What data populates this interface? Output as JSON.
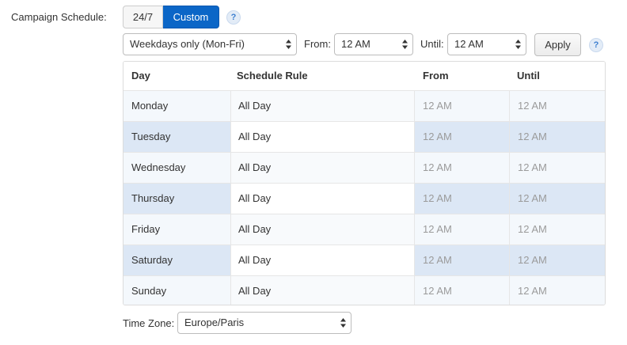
{
  "campaign_schedule": {
    "label": "Campaign Schedule:",
    "toggle": {
      "option_247": "24/7",
      "option_custom": "Custom",
      "selected": "Custom"
    },
    "help": "?"
  },
  "controls": {
    "preset": "Weekdays only (Mon-Fri)",
    "from_label": "From:",
    "from_value": "12 AM",
    "until_label": "Until:",
    "until_value": "12 AM",
    "apply_label": "Apply",
    "help": "?"
  },
  "table": {
    "headers": {
      "day": "Day",
      "rule": "Schedule Rule",
      "from": "From",
      "until": "Until"
    },
    "rows": [
      {
        "day": "Monday",
        "rule": "All Day",
        "from": "12 AM",
        "until": "12 AM"
      },
      {
        "day": "Tuesday",
        "rule": "All Day",
        "from": "12 AM",
        "until": "12 AM"
      },
      {
        "day": "Wednesday",
        "rule": "All Day",
        "from": "12 AM",
        "until": "12 AM"
      },
      {
        "day": "Thursday",
        "rule": "All Day",
        "from": "12 AM",
        "until": "12 AM"
      },
      {
        "day": "Friday",
        "rule": "All Day",
        "from": "12 AM",
        "until": "12 AM"
      },
      {
        "day": "Saturday",
        "rule": "All Day",
        "from": "12 AM",
        "until": "12 AM"
      },
      {
        "day": "Sunday",
        "rule": "All Day",
        "from": "12 AM",
        "until": "12 AM"
      }
    ]
  },
  "timezone": {
    "label": "Time Zone:",
    "value": "Europe/Paris"
  },
  "colors": {
    "accent": "#0b66c7",
    "row_alt": "#dce7f5",
    "muted_text": "#9b9b9b"
  },
  "icons": {
    "select_caret": "updown-caret-icon",
    "help": "help-icon"
  }
}
